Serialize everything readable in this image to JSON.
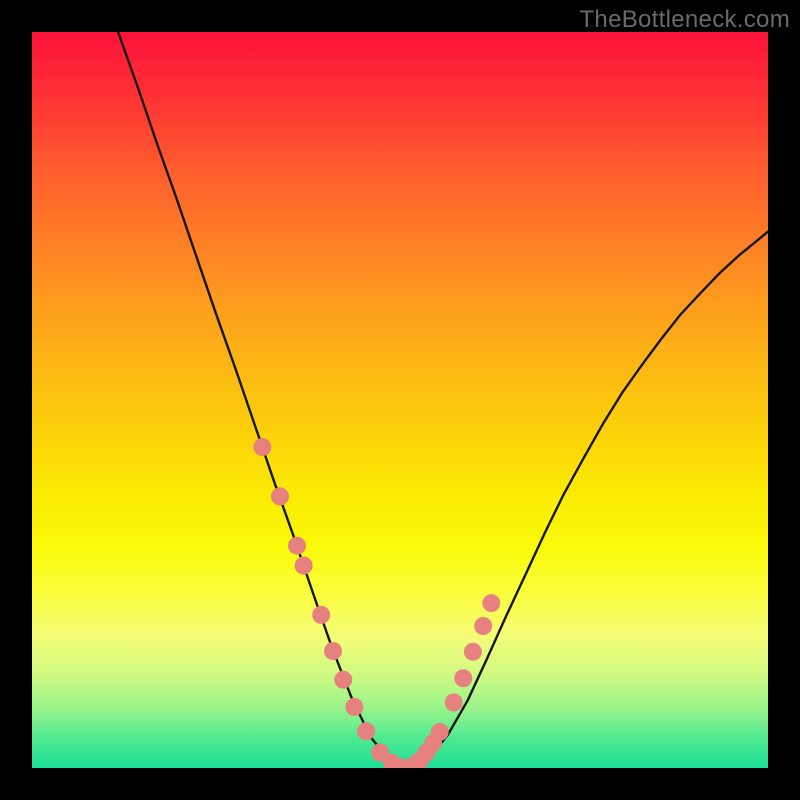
{
  "watermark": "TheBottleneck.com",
  "colors": {
    "page_bg": "#000000",
    "curve_stroke": "#171616",
    "marker_fill": "#e78180",
    "gradient_top": "#fd1239",
    "gradient_bottom": "#1cdf96"
  },
  "chart_data": {
    "type": "line",
    "title": "",
    "xlabel": "",
    "ylabel": "",
    "xlim": [
      0,
      100
    ],
    "ylim": [
      0,
      100
    ],
    "grid": false,
    "note": "No numeric axis ticks or labels are rendered; values are estimated from pixel positions.",
    "series": [
      {
        "name": "curve",
        "x": [
          11.7,
          14.4,
          17.0,
          19.7,
          22.3,
          24.9,
          27.6,
          30.2,
          32.8,
          35.5,
          38.1,
          40.7,
          43.4,
          46.0,
          48.6,
          51.3,
          53.9,
          56.5,
          59.2,
          61.8,
          64.4,
          67.1,
          69.7,
          72.3,
          75.0,
          77.6,
          80.2,
          82.9,
          85.5,
          88.1,
          90.8,
          93.4,
          96.0,
          98.7,
          100.0
        ],
        "y": [
          100.0,
          92.4,
          84.8,
          77.2,
          69.6,
          62.0,
          54.4,
          46.8,
          39.2,
          31.6,
          24.0,
          16.5,
          9.6,
          4.2,
          1.0,
          0.0,
          1.3,
          4.5,
          9.2,
          14.8,
          20.6,
          26.4,
          32.0,
          37.3,
          42.2,
          46.8,
          51.0,
          54.8,
          58.3,
          61.6,
          64.5,
          67.2,
          69.6,
          71.8,
          72.9
        ]
      }
    ],
    "markers": [
      {
        "name": "lower-segment-points",
        "shape": "circle",
        "color": "#e78180",
        "x": [
          31.3,
          33.7,
          36.0,
          36.9,
          39.3,
          40.9,
          42.3,
          43.8,
          45.4,
          47.3,
          48.9,
          50.1,
          51.7,
          52.7,
          53.6,
          54.5,
          55.4,
          57.3,
          58.6,
          59.9,
          61.3,
          62.4
        ],
        "y": [
          43.6,
          36.9,
          30.2,
          27.5,
          20.8,
          15.9,
          12.0,
          8.3,
          5.0,
          2.1,
          0.7,
          0.1,
          0.3,
          1.0,
          2.1,
          3.4,
          4.9,
          8.9,
          12.2,
          15.8,
          19.3,
          22.4
        ]
      }
    ]
  }
}
